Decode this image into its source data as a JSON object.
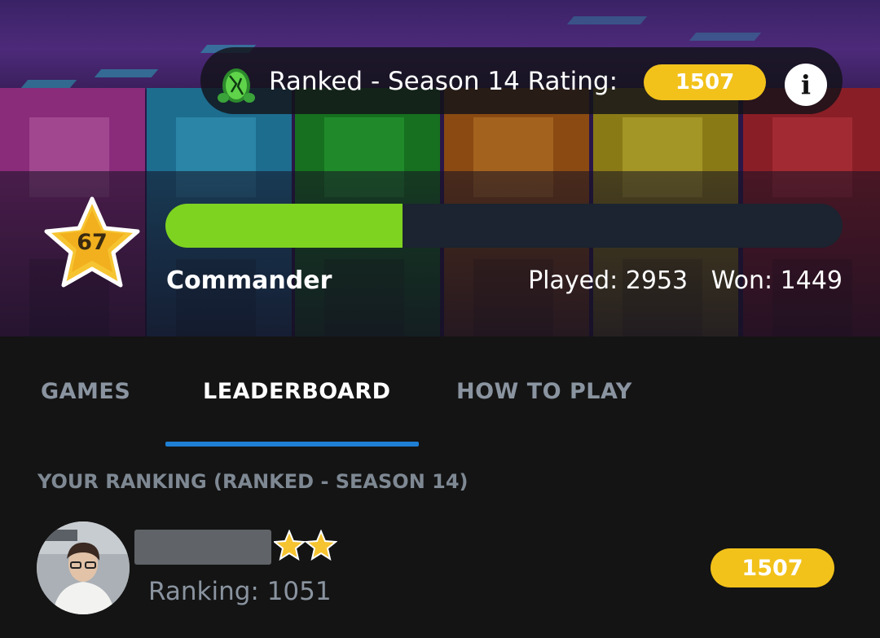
{
  "header": {
    "rating_label": "Ranked - Season 14 Rating:",
    "rating_value": "1507",
    "info_icon": "info-icon",
    "egg_icon": "egg-icon"
  },
  "player": {
    "level": "67",
    "xp_progress_fraction": 0.35,
    "rank_title": "Commander",
    "played_label": "Played: 2953",
    "won_label": "Won: 1449"
  },
  "tabs": [
    {
      "label": "GAMES",
      "active": false
    },
    {
      "label": "LEADERBOARD",
      "active": true
    },
    {
      "label": "HOW TO PLAY",
      "active": false
    }
  ],
  "ranking": {
    "section_title": "YOUR RANKING (RANKED - SEASON 14)",
    "ranking_label": "Ranking: 1051",
    "rating_value": "1507",
    "stars": 2
  },
  "colors": {
    "accent_yellow": "#f2c21b",
    "xp_green": "#7ed321",
    "tab_indicator": "#1e7fd4"
  }
}
